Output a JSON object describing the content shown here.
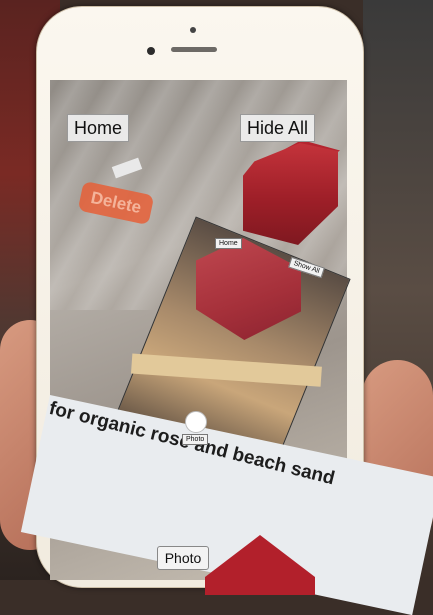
{
  "screen": {
    "home_label": "Home",
    "hide_all_label": "Hide All",
    "delete_label": "Delete",
    "photo_label": "Photo",
    "caption_text": "for organic rose and beach sand"
  },
  "inner_screen": {
    "home_label": "Home",
    "show_all_label": "Show All",
    "photo_label": "Photo"
  },
  "colors": {
    "cube_red": "#b4252f",
    "delete_orange": "#e65f37"
  }
}
